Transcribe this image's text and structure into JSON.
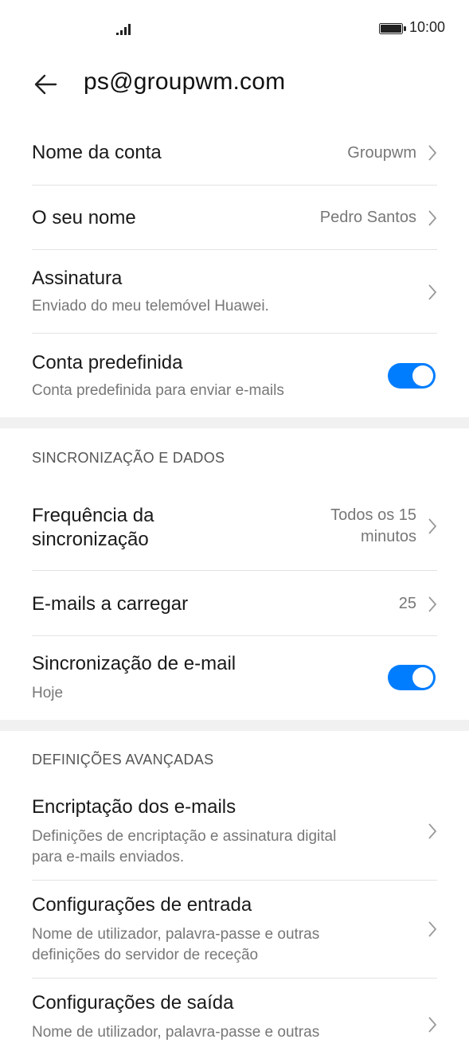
{
  "status": {
    "time": "10:00"
  },
  "header": {
    "title": "ps@groupwm.com"
  },
  "account": {
    "name": {
      "label": "Nome da conta",
      "value": "Groupwm"
    },
    "your_name": {
      "label": "O seu nome",
      "value": "Pedro Santos"
    },
    "signature": {
      "label": "Assinatura",
      "value": "Enviado do meu telemóvel Huawei."
    },
    "default_account": {
      "label": "Conta predefinida",
      "description": "Conta predefinida para enviar e-mails",
      "enabled": true
    }
  },
  "sync": {
    "section_title": "SINCRONIZAÇÃO E DADOS",
    "frequency": {
      "label_line1": "Frequência da",
      "label_line2": "sincronização",
      "value_line1": "Todos os 15",
      "value_line2": "minutos"
    },
    "emails_to_load": {
      "label": "E-mails a carregar",
      "value": "25"
    },
    "email_sync": {
      "label": "Sincronização de e-mail",
      "description": "Hoje",
      "enabled": true
    }
  },
  "advanced": {
    "section_title": "DEFINIÇÕES AVANÇADAS",
    "encryption": {
      "label": "Encriptação dos e-mails",
      "desc_line1": "Definições de encriptação e assinatura digital",
      "desc_line2": "para e-mails enviados."
    },
    "incoming": {
      "label": "Configurações de entrada",
      "desc_line1": "Nome de utilizador, palavra-passe e outras",
      "desc_line2": "definições do servidor de receção"
    },
    "outgoing": {
      "label": "Configurações de saída",
      "desc_line1": "Nome de utilizador, palavra-passe e outras"
    }
  },
  "colors": {
    "accent": "#007dff",
    "band": "#f1f1f1",
    "secondary_text": "#777777"
  }
}
